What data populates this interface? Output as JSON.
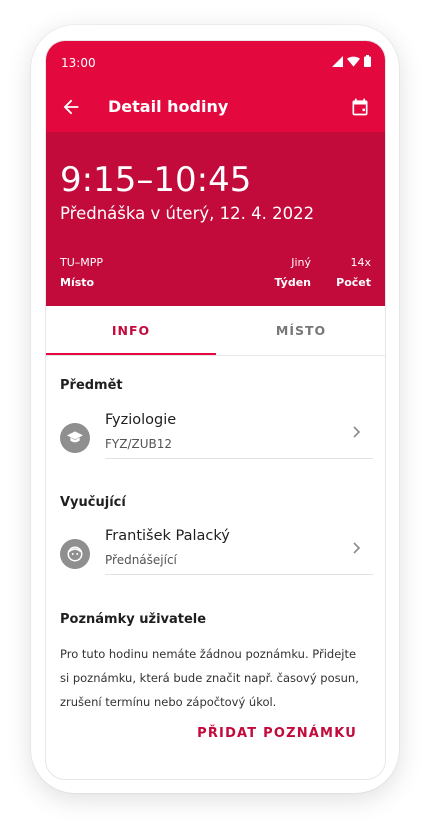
{
  "status_bar": {
    "time": "13:00"
  },
  "appbar": {
    "title": "Detail hodiny"
  },
  "hero": {
    "time_range": "9:15–10:45",
    "subtitle": "Přednáška v úterý, 12. 4. 2022",
    "place_value": "TU–MPP",
    "place_label": "Místo",
    "week_value": "Jiný",
    "week_label": "Týden",
    "count_value": "14x",
    "count_label": "Počet"
  },
  "tabs": {
    "info": "INFO",
    "place": "MÍSTO"
  },
  "subject": {
    "section": "Předmět",
    "name": "Fyziologie",
    "code": "FYZ/ZUB12"
  },
  "teacher": {
    "section": "Vyučující",
    "name": "František Palacký",
    "role": "Přednášející"
  },
  "notes": {
    "section": "Poznámky uživatele",
    "text": "Pro tuto hodinu nemáte žádnou poznámku. Přidejte si poznámku, která bude značit např. časový posun, zrušení termínu nebo zápočtový úkol.",
    "add_button": "PŘIDAT POZNÁMKU"
  },
  "colors": {
    "primary": "#e3093f",
    "primary_dark": "#c20a3b",
    "accent_text": "#c20a3b"
  },
  "icons": [
    "back-arrow-icon",
    "calendar-icon",
    "signal-icon",
    "wifi-icon",
    "battery-icon",
    "graduation-cap-icon",
    "face-icon",
    "chevron-right-icon"
  ]
}
